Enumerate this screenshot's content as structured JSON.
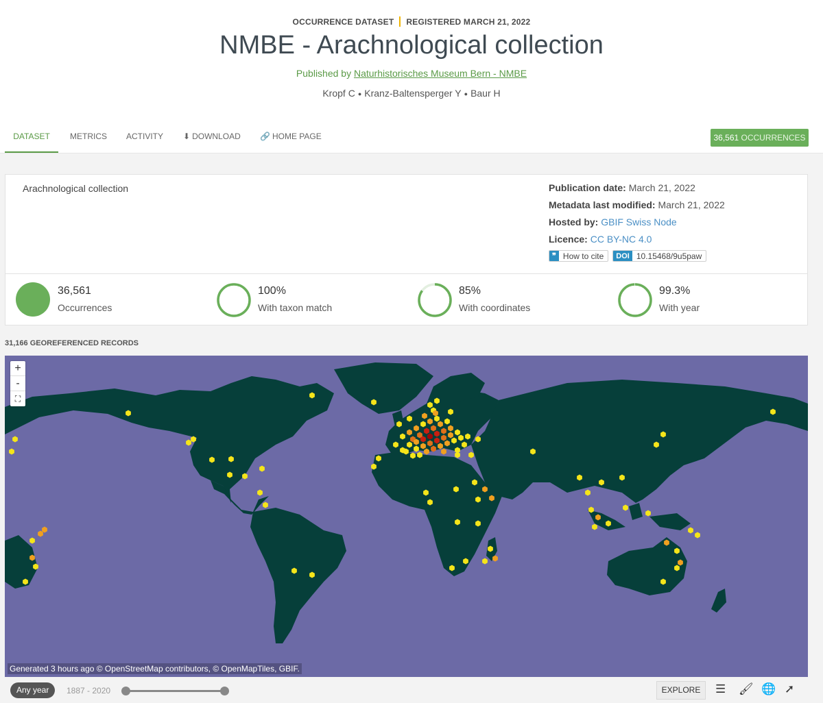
{
  "header": {
    "type": "OCCURRENCE DATASET",
    "registered": "REGISTERED MARCH 21, 2022",
    "title": "NMBE - Arachnological collection",
    "published_by_prefix": "Published by",
    "publisher": "Naturhistorisches Museum Bern - NMBE",
    "authors": [
      "Kropf C",
      "Kranz-Baltensperger Y",
      "Baur H"
    ]
  },
  "tabs": [
    {
      "label": "DATASET",
      "icon": ""
    },
    {
      "label": "METRICS",
      "icon": ""
    },
    {
      "label": "ACTIVITY",
      "icon": ""
    },
    {
      "label": "DOWNLOAD",
      "icon": "download-icon"
    },
    {
      "label": "HOME PAGE",
      "icon": "link-icon"
    }
  ],
  "occurrences_badge": {
    "count": "36,561",
    "label": "OCCURRENCES"
  },
  "summary": {
    "description": "Arachnological collection",
    "publication_date_label": "Publication date:",
    "publication_date": "March 21, 2022",
    "metadata_modified_label": "Metadata last modified:",
    "metadata_modified": "March 21, 2022",
    "hosted_by_label": "Hosted by:",
    "hosted_by": "GBIF Swiss Node",
    "licence_label": "Licence:",
    "licence": "CC BY-NC 4.0",
    "how_to_cite": "How to cite",
    "doi_tag": "DOI",
    "doi": "10.15468/9u5paw"
  },
  "stats": [
    {
      "value": "36,561",
      "label": "Occurrences",
      "fraction": 1.0,
      "filled": true
    },
    {
      "value": "100%",
      "label": "With taxon match",
      "fraction": 1.0,
      "filled": false
    },
    {
      "value": "85%",
      "label": "With coordinates",
      "fraction": 0.85,
      "filled": false
    },
    {
      "value": "99.3%",
      "label": "With year",
      "fraction": 0.993,
      "filled": false
    }
  ],
  "map": {
    "georeferenced_label": "31,166 GEOREFERENCED RECORDS",
    "zoom_in": "+",
    "zoom_out": "-",
    "attribution": "Generated 3 hours ago © OpenStreetMap contributors, © OpenMapTiles, GBIF."
  },
  "bottombar": {
    "any_year": "Any year",
    "year_range": "1887 - 2020",
    "explore": "EXPLORE"
  },
  "colors": {
    "accent": "#5a9a46",
    "badge": "#6aaf5a",
    "ocean": "#6c6aa6",
    "land": "#063f3a",
    "link": "#4a8fc5"
  }
}
